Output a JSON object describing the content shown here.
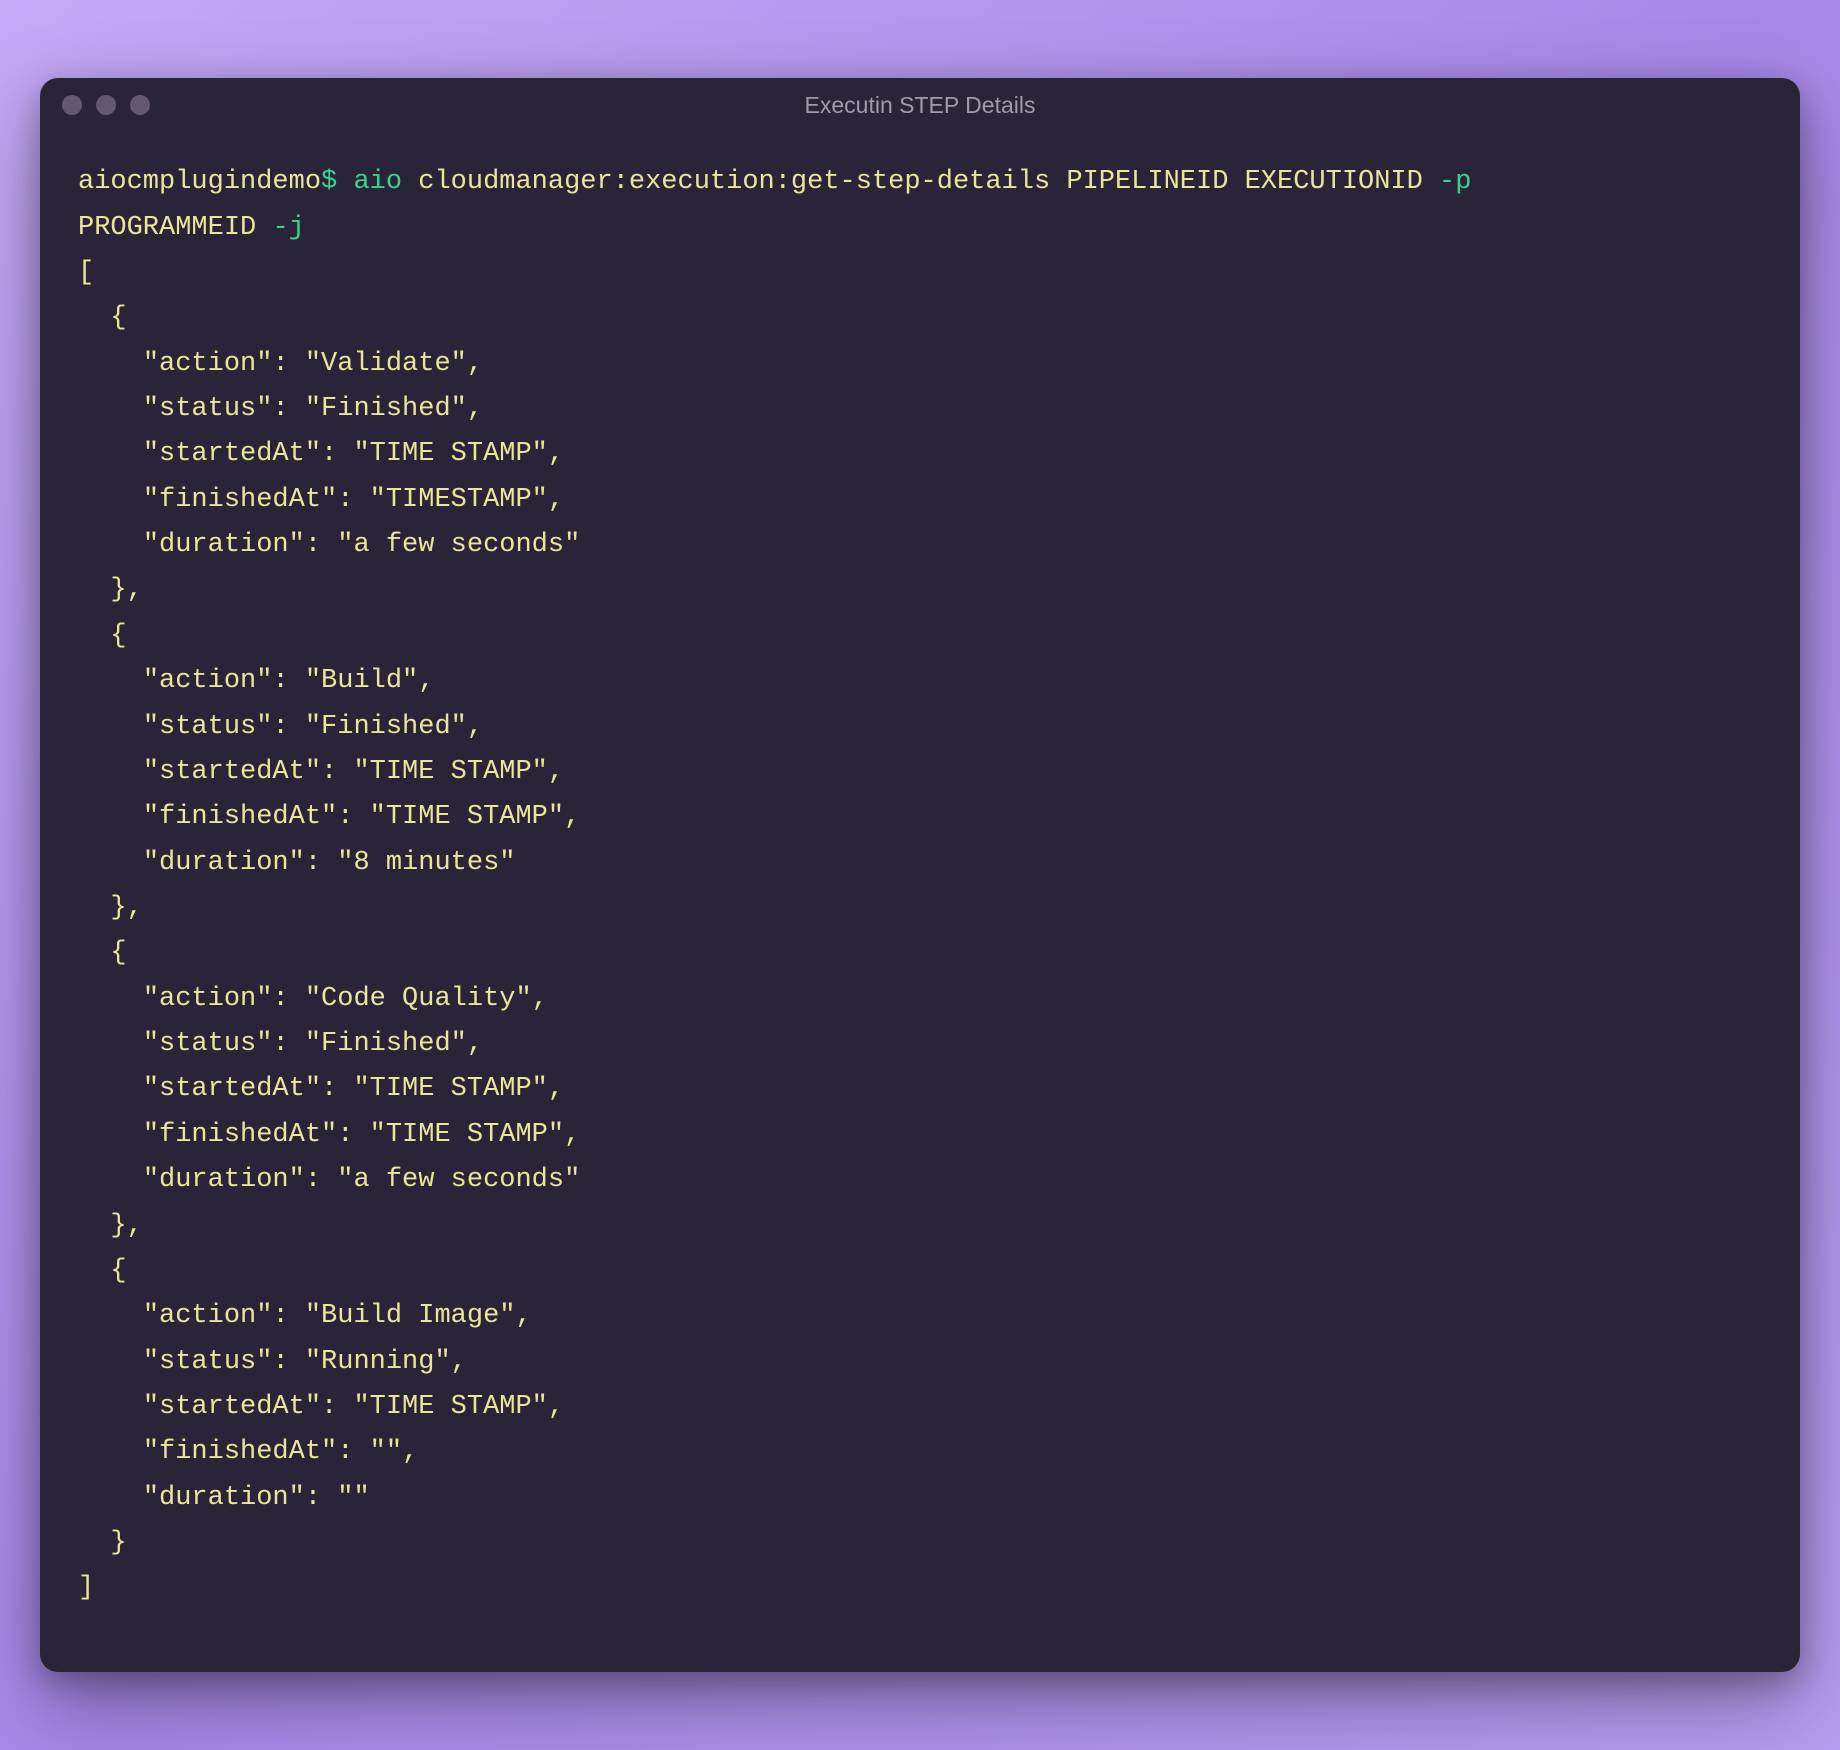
{
  "window": {
    "title": "Executin STEP Details"
  },
  "prompt": {
    "host": "aiocmplugindemo",
    "dollar": "$",
    "bin": "aio",
    "command_part1": "cloudmanager:execution:get-step-details PIPELINEID EXECUTIONID",
    "flag1": "-p",
    "command_part2": "PROGRAMMEID",
    "flag2": "-j"
  },
  "json_output": {
    "open_bracket": "[",
    "close_bracket": "]",
    "open_brace": "{",
    "close_brace": "}",
    "close_brace_comma": "},",
    "k_action": "\"action\"",
    "k_status": "\"status\"",
    "k_startedAt": "\"startedAt\"",
    "k_finishedAt": "\"finishedAt\"",
    "k_duration": "\"duration\"",
    "colon_sp": ": ",
    "comma": ",",
    "steps": [
      {
        "action": "\"Validate\"",
        "status": "\"Finished\"",
        "startedAt": "\"TIME STAMP\"",
        "finishedAt": "\"TIMESTAMP\"",
        "duration": "\"a few seconds\""
      },
      {
        "action": "\"Build\"",
        "status": "\"Finished\"",
        "startedAt": "\"TIME STAMP\"",
        "finishedAt": "\"TIME STAMP\"",
        "duration": "\"8 minutes\""
      },
      {
        "action": "\"Code Quality\"",
        "status": "\"Finished\"",
        "startedAt": "\"TIME STAMP\"",
        "finishedAt": "\"TIME STAMP\"",
        "duration": "\"a few seconds\""
      },
      {
        "action": "\"Build Image\"",
        "status": "\"Running\"",
        "startedAt": "\"TIME STAMP\"",
        "finishedAt": "\"\"",
        "duration": "\"\""
      }
    ]
  }
}
